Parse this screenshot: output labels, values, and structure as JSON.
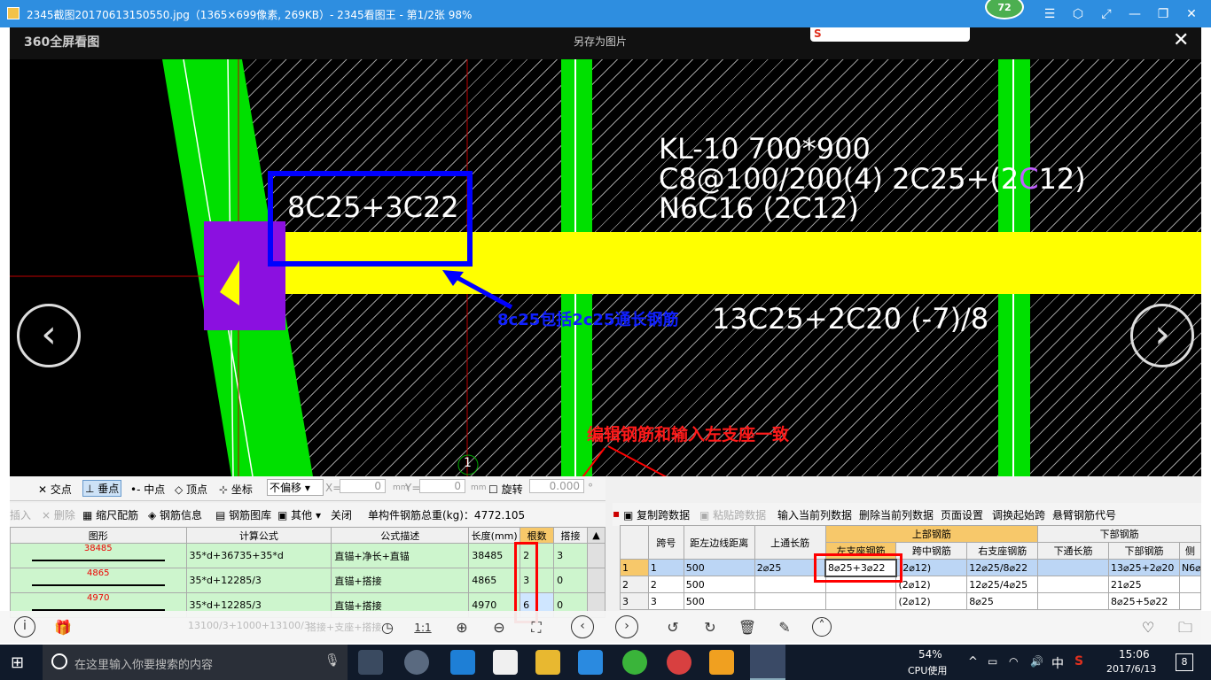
{
  "window": {
    "title": "2345截图20170613150550.jpg（1365×699像素, 269KB）- 2345看图王 - 第1/2张 98%",
    "badge": "72"
  },
  "viewer": {
    "logo": "360全屏看图",
    "save_as": "另存为图片",
    "page_marker": "1"
  },
  "cad": {
    "beam_l1": "KL-10 700*900",
    "beam_l2_a": "C8@100/200(4) 2C25+(2",
    "beam_l2_b": "C",
    "beam_l2_c": "12)",
    "beam_l3": "N6C16      (2C12)",
    "support_label": "8C25+3C22",
    "bottom_label": "13C25+2C20 (-7)/8",
    "note_blue": "8c25包括2c25通长钢筋",
    "note_red": "编辑钢筋和输入左支座一致"
  },
  "snapbar": {
    "items": [
      "交点",
      "垂点",
      "中点",
      "顶点",
      "坐标"
    ],
    "offset_mode": "不偏移",
    "x_label": "X=",
    "x_value": "0",
    "y_label": "Y=",
    "y_value": "0",
    "unit": "mm",
    "rotate_label": "旋转",
    "rotate_value": "0.000",
    "deg": "°"
  },
  "left_toolbar": {
    "insert": "插入",
    "delete": "删除",
    "scale": "缩尺配筋",
    "rebar_info": "钢筋信息",
    "rebar_lib": "钢筋图库",
    "other": "其他",
    "close": "关闭",
    "total_label": "单构件钢筋总重(kg)：4772.105"
  },
  "left_table": {
    "headers": [
      "图形",
      "计算公式",
      "公式描述",
      "长度(mm)",
      "根数",
      "搭接"
    ],
    "rows": [
      {
        "shape": "38485",
        "formula": "35*d+36735+35*d",
        "desc": "直锚+净长+直锚",
        "length": "38485",
        "count": "2",
        "lap": "3"
      },
      {
        "shape": "4865",
        "formula": "35*d+12285/3",
        "desc": "直锚+搭接",
        "length": "4865",
        "count": "3",
        "lap": "0"
      },
      {
        "shape": "4970",
        "formula": "35*d+12285/3",
        "desc": "直锚+搭接",
        "length": "4970",
        "count": "6",
        "lap": "0"
      }
    ]
  },
  "right_toolbar": {
    "copy": "复制跨数据",
    "paste": "粘贴跨数据",
    "input_col": "输入当前列数据",
    "delete_col": "删除当前列数据",
    "page_setup": "页面设置",
    "adjust_span": "调换起始跨",
    "cantilever": "悬臂钢筋代号"
  },
  "right_table": {
    "group_top": "上部钢筋",
    "group_bottom": "下部钢筋",
    "headers": [
      "跨号",
      "距左边线距离",
      "上通长筋",
      "左支座钢筋",
      "跨中钢筋",
      "右支座钢筋",
      "下通长筋",
      "下部钢筋",
      "侧"
    ],
    "rows": [
      {
        "idx": "1",
        "span": "1",
        "dist": "500",
        "top": "2⌀25",
        "left": "8⌀25+3⌀22",
        "mid": "(2⌀12)",
        "right": "12⌀25/8⌀22",
        "bot_through": "",
        "bottom": "13⌀25+2⌀20",
        "side": "N6⌀"
      },
      {
        "idx": "2",
        "span": "2",
        "dist": "500",
        "top": "",
        "left": "",
        "mid": "(2⌀12)",
        "right": "12⌀25/4⌀25",
        "bot_through": "",
        "bottom": "21⌀25",
        "side": ""
      },
      {
        "idx": "3",
        "span": "3",
        "dist": "500",
        "top": "",
        "left": "",
        "mid": "(2⌀12)",
        "right": "8⌀25",
        "bot_through": "",
        "bottom": "8⌀25+5⌀22",
        "side": ""
      }
    ]
  },
  "bottom_strip": {
    "formula": "13100/3+1000+13100/3",
    "desc": "搭接+支座+搭接",
    "ratio": "1:1"
  },
  "taskbar": {
    "search_placeholder": "在这里输入你要搜索的内容",
    "cpu_percent": "54%",
    "cpu_label": "CPU使用",
    "ime": "中",
    "time": "15:06",
    "date": "2017/6/13",
    "notif": "8"
  }
}
